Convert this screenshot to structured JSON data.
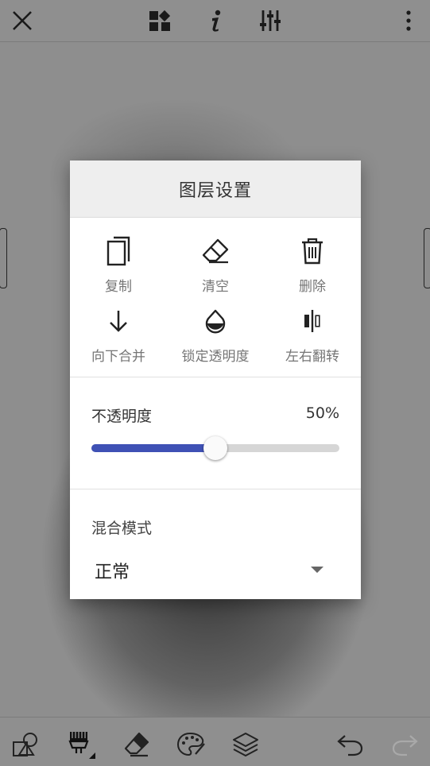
{
  "topbar": {
    "icons": [
      "close-icon",
      "dashboard-icon",
      "info-icon",
      "adjust-sliders-icon",
      "more-vert-icon"
    ]
  },
  "dialog": {
    "title": "图层设置",
    "actions": [
      {
        "label": "复制",
        "icon": "copy-icon"
      },
      {
        "label": "清空",
        "icon": "eraser-icon"
      },
      {
        "label": "删除",
        "icon": "trash-icon"
      },
      {
        "label": "向下合并",
        "icon": "arrow-down-icon"
      },
      {
        "label": "锁定透明度",
        "icon": "drop-icon"
      },
      {
        "label": "左右翻转",
        "icon": "flip-horizontal-icon"
      }
    ],
    "opacity": {
      "label": "不透明度",
      "value_text": "50%",
      "value": 0.5
    },
    "blend": {
      "label": "混合模式",
      "value": "正常"
    }
  },
  "bottombar": {
    "icons": [
      "shapes-icon",
      "brush-icon",
      "eraser-icon",
      "palette-icon",
      "layers-icon",
      "undo-icon",
      "redo-icon"
    ]
  },
  "colors": {
    "accent": "#3f51b5",
    "track": "#d6d6d6",
    "header_bg": "#eeeeee"
  }
}
